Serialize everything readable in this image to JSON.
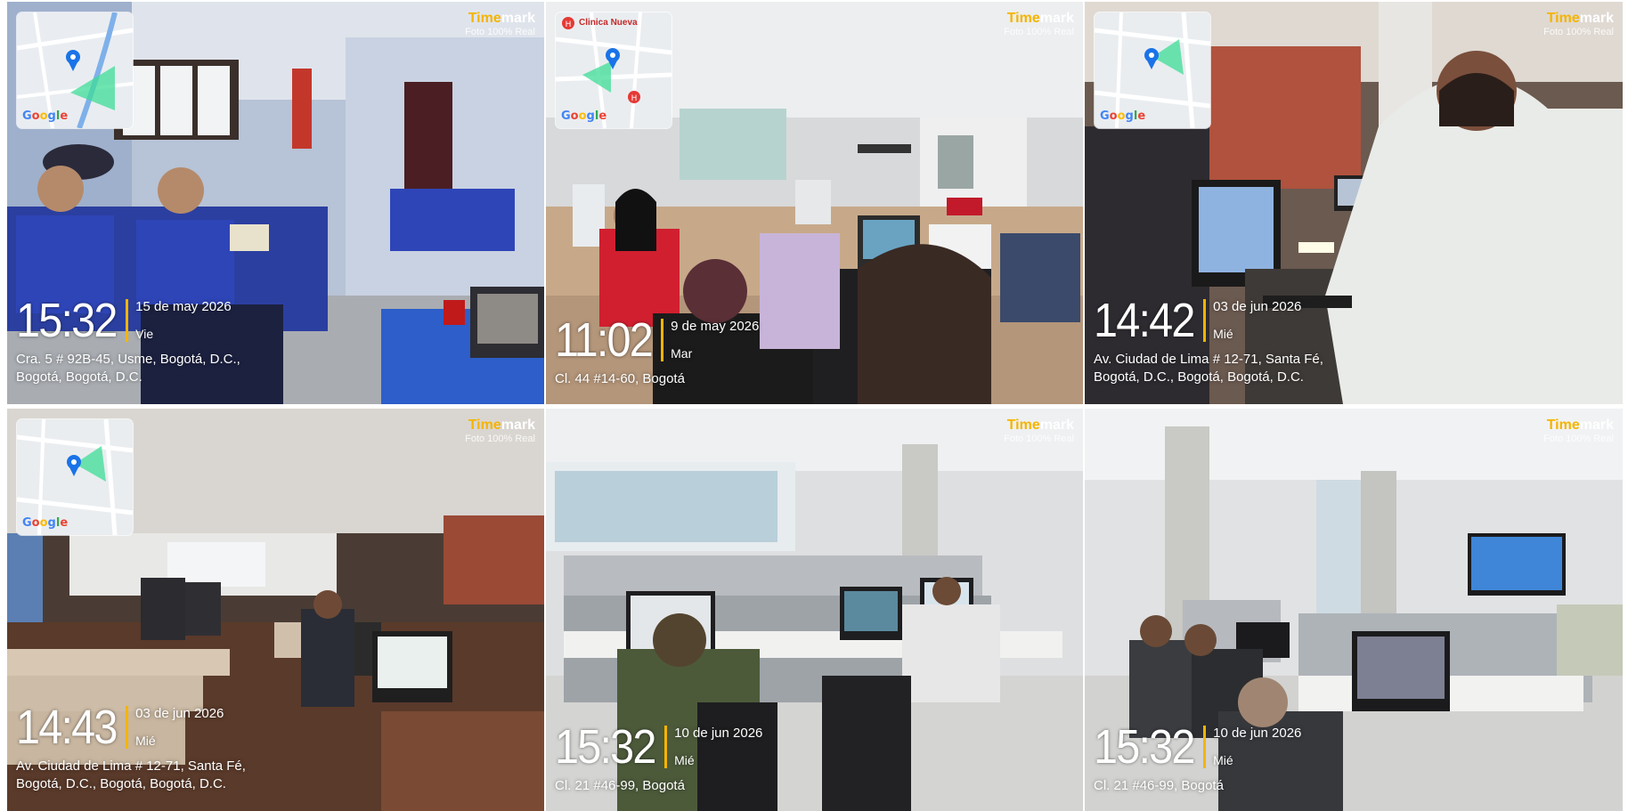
{
  "brand": {
    "name_part1": "Time",
    "name_part2": "mark",
    "subtitle": "Foto 100% Real",
    "accent_color": "#f5b400"
  },
  "map_logo": "Google",
  "photos": [
    {
      "time": "15:32",
      "date": "15 de may 2026",
      "day": "Vie",
      "address_line1": "Cra. 5 # 92B-45, Usme, Bogotá, D.C.,",
      "address_line2": "Bogotá, Bogotá, D.C."
    },
    {
      "time": "11:02",
      "date": "9 de may 2026",
      "day": "Mar",
      "address_line1": "Cl. 44 #14-60, Bogotá",
      "address_line2": "",
      "map_label": "Clinica Nueva"
    },
    {
      "time": "14:42",
      "date": "03 de jun 2026",
      "day": "Mié",
      "address_line1": "Av. Ciudad de Lima # 12-71, Santa Fé,",
      "address_line2": "Bogotá, D.C., Bogotá, Bogotá, D.C."
    },
    {
      "time": "14:43",
      "date": "03 de jun 2026",
      "day": "Mié",
      "address_line1": "Av. Ciudad de Lima # 12-71, Santa Fé,",
      "address_line2": "Bogotá, D.C., Bogotá, Bogotá, D.C."
    },
    {
      "time": "15:32",
      "date": "10 de jun 2026",
      "day": "Mié",
      "address_line1": "Cl. 21 #46-99, Bogotá",
      "address_line2": ""
    },
    {
      "time": "15:32",
      "date": "10 de jun 2026",
      "day": "Mié",
      "address_line1": "Cl. 21 #46-99, Bogotá",
      "address_line2": ""
    }
  ]
}
